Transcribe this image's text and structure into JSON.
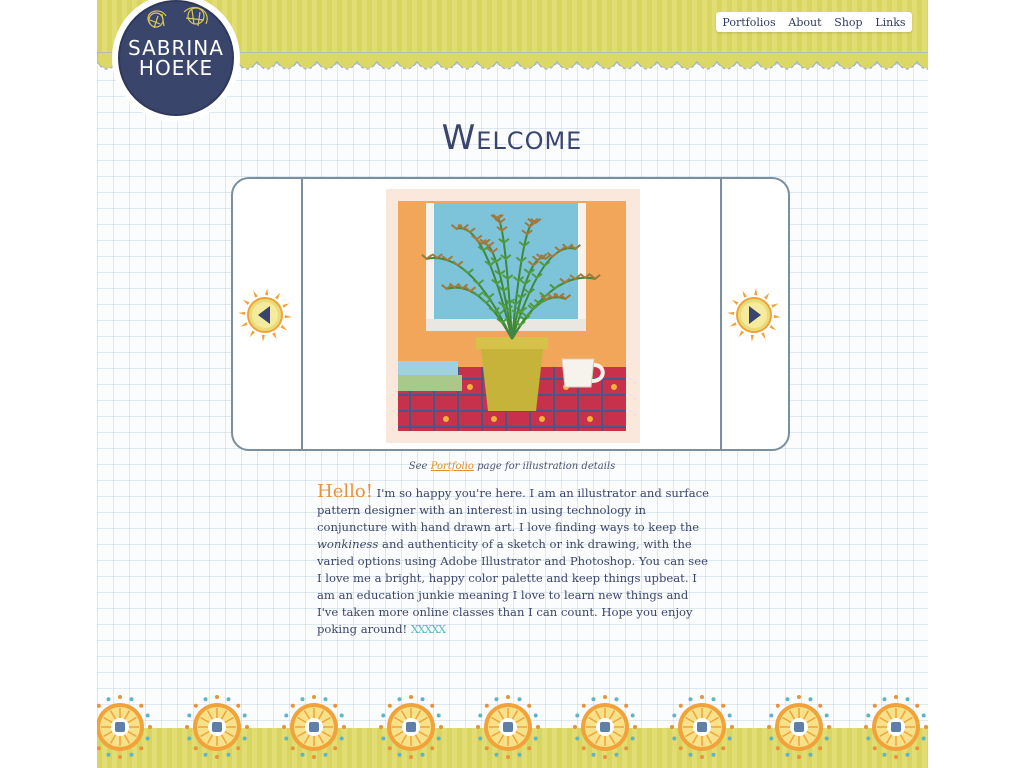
{
  "logo": {
    "line1": "SABRINA",
    "line2": "HOEKE"
  },
  "nav": {
    "items": [
      {
        "label": "Portfolios"
      },
      {
        "label": "About"
      },
      {
        "label": "Shop"
      },
      {
        "label": "Links"
      }
    ]
  },
  "page_title": "Welcome",
  "slider": {
    "prev_icon": "left-arrow-sun-icon",
    "next_icon": "right-arrow-sun-icon"
  },
  "caption": {
    "before": "See ",
    "link": "Portfolio",
    "after": " page for illustration details"
  },
  "intro": {
    "hello": "Hello!",
    "part1": " I'm so happy you're here. I am an illustrator and surface pattern designer with an interest in using technology in conjuncture with hand drawn art. I love finding ways to keep the ",
    "emphasis": "wonkiness",
    "part2": " and authenticity of a sketch or ink drawing, with the varied options using Adobe Illustrator and Photoshop. You can see I love me a bright, happy color palette and keep things upbeat. I am an education junkie meaning I love to learn new things and I've taken more online classes than I can count. Hope you enjoy poking around! ",
    "stitch": "XXXXX"
  },
  "colors": {
    "navy": "#39456b",
    "yellow": "#dcd867",
    "orange": "#e8923a",
    "teal": "#5fb4c8",
    "grid": "#aac3d7"
  }
}
